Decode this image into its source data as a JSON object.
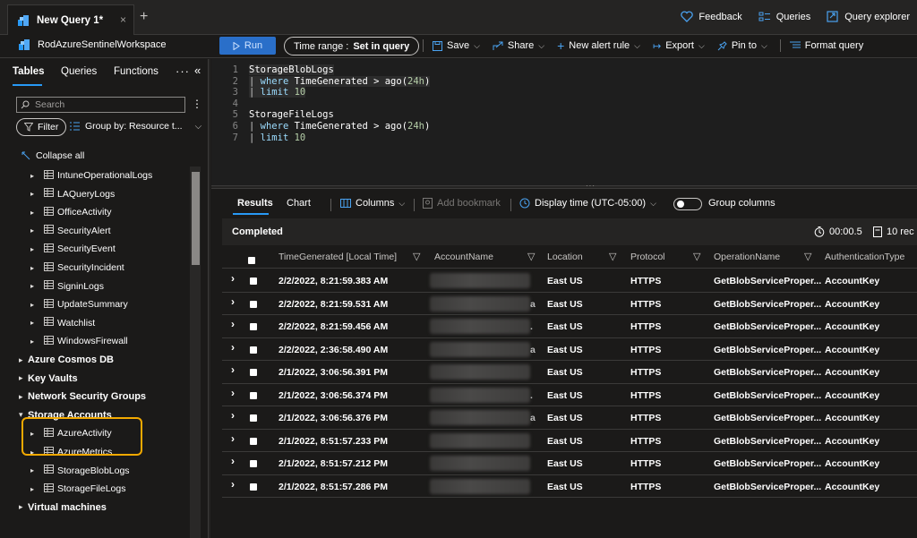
{
  "window": {
    "tab_title": "New Query 1*",
    "tab_close": "×",
    "tab_add": "+",
    "top_actions": [
      {
        "label": "Feedback",
        "icon": "heart-icon"
      },
      {
        "label": "Queries",
        "icon": "queries-icon"
      },
      {
        "label": "Query explorer",
        "icon": "query-explorer-icon"
      }
    ]
  },
  "toolbar": {
    "workspace": "RodAzureSentinelWorkspace",
    "run_label": "Run",
    "time_range_label": "Time range :",
    "time_range_value": "Set in query",
    "save_label": "Save",
    "share_label": "Share",
    "new_alert_label": "New alert rule",
    "export_label": "Export",
    "pin_label": "Pin to",
    "format_label": "Format query"
  },
  "left": {
    "tabs": [
      "Tables",
      "Queries",
      "Functions"
    ],
    "more": "···",
    "collapse": "«",
    "search_placeholder": "Search",
    "search_more": "⋮",
    "filter_label": "Filter",
    "groupby_label": "Group by: Resource t...",
    "collapse_all": "Collapse all",
    "tree": [
      {
        "label": "IntuneOperationalLogs",
        "kind": "table"
      },
      {
        "label": "LAQueryLogs",
        "kind": "table"
      },
      {
        "label": "OfficeActivity",
        "kind": "table"
      },
      {
        "label": "SecurityAlert",
        "kind": "table"
      },
      {
        "label": "SecurityEvent",
        "kind": "table"
      },
      {
        "label": "SecurityIncident",
        "kind": "table"
      },
      {
        "label": "SigninLogs",
        "kind": "table"
      },
      {
        "label": "UpdateSummary",
        "kind": "table"
      },
      {
        "label": "Watchlist",
        "kind": "table"
      },
      {
        "label": "WindowsFirewall",
        "kind": "table"
      },
      {
        "label": "Azure Cosmos DB",
        "kind": "group"
      },
      {
        "label": "Key Vaults",
        "kind": "group"
      },
      {
        "label": "Network Security Groups",
        "kind": "group"
      },
      {
        "label": "Storage Accounts",
        "kind": "group-open"
      },
      {
        "label": "AzureActivity",
        "kind": "table"
      },
      {
        "label": "AzureMetrics",
        "kind": "table"
      },
      {
        "label": "StorageBlobLogs",
        "kind": "table"
      },
      {
        "label": "StorageFileLogs",
        "kind": "table"
      },
      {
        "label": "Virtual machines",
        "kind": "group"
      }
    ]
  },
  "editor": {
    "lines": [
      {
        "n": "1",
        "segments": [
          [
            "StorageBlobLogs",
            "plain"
          ]
        ]
      },
      {
        "n": "2",
        "segments": [
          [
            "| ",
            "pipe"
          ],
          [
            "where",
            "kw"
          ],
          [
            " TimeGenerated > ago(",
            "plain"
          ],
          [
            "24h",
            "num"
          ],
          [
            ")",
            "plain"
          ]
        ]
      },
      {
        "n": "3",
        "segments": [
          [
            "| ",
            "pipe"
          ],
          [
            "limit",
            "kw"
          ],
          [
            " ",
            "plain"
          ],
          [
            "10",
            "num"
          ]
        ]
      },
      {
        "n": "4",
        "segments": []
      },
      {
        "n": "5",
        "segments": [
          [
            "StorageFileLogs",
            "plain"
          ]
        ]
      },
      {
        "n": "6",
        "segments": [
          [
            "| ",
            "pipe"
          ],
          [
            "where",
            "kw"
          ],
          [
            " TimeGenerated > ago(",
            "plain"
          ],
          [
            "24h",
            "num"
          ],
          [
            ")",
            "plain"
          ]
        ]
      },
      {
        "n": "7",
        "segments": [
          [
            "| ",
            "pipe"
          ],
          [
            "limit",
            "kw"
          ],
          [
            " ",
            "plain"
          ],
          [
            "10",
            "num"
          ]
        ]
      }
    ]
  },
  "results": {
    "tabs": [
      "Results",
      "Chart"
    ],
    "columns_label": "Columns",
    "bookmark_label": "Add bookmark",
    "display_time_label": "Display time (UTC-05:00)",
    "group_columns_label": "Group columns",
    "status": "Completed",
    "duration": "00:00.5",
    "records": "10 rec",
    "headers": [
      "TimeGenerated [Local Time]",
      "AccountName",
      "Location",
      "Protocol",
      "OperationName",
      "AuthenticationType"
    ],
    "rows": [
      {
        "time": "2/2/2022, 8:21:59.383 AM",
        "tail": "",
        "location": "East US",
        "protocol": "HTTPS",
        "operation": "GetBlobServiceProper...",
        "auth": "AccountKey"
      },
      {
        "time": "2/2/2022, 8:21:59.531 AM",
        "tail": "a",
        "location": "East US",
        "protocol": "HTTPS",
        "operation": "GetBlobServiceProper...",
        "auth": "AccountKey"
      },
      {
        "time": "2/2/2022, 8:21:59.456 AM",
        "tail": ".",
        "location": "East US",
        "protocol": "HTTPS",
        "operation": "GetBlobServiceProper...",
        "auth": "AccountKey"
      },
      {
        "time": "2/2/2022, 2:36:58.490 AM",
        "tail": "a",
        "location": "East US",
        "protocol": "HTTPS",
        "operation": "GetBlobServiceProper...",
        "auth": "AccountKey"
      },
      {
        "time": "2/1/2022, 3:06:56.391 PM",
        "tail": "",
        "location": "East US",
        "protocol": "HTTPS",
        "operation": "GetBlobServiceProper...",
        "auth": "AccountKey"
      },
      {
        "time": "2/1/2022, 3:06:56.374 PM",
        "tail": ".",
        "location": "East US",
        "protocol": "HTTPS",
        "operation": "GetBlobServiceProper...",
        "auth": "AccountKey"
      },
      {
        "time": "2/1/2022, 3:06:56.376 PM",
        "tail": "a",
        "location": "East US",
        "protocol": "HTTPS",
        "operation": "GetBlobServiceProper...",
        "auth": "AccountKey"
      },
      {
        "time": "2/1/2022, 8:51:57.233 PM",
        "tail": "",
        "location": "East US",
        "protocol": "HTTPS",
        "operation": "GetBlobServiceProper...",
        "auth": "AccountKey"
      },
      {
        "time": "2/1/2022, 8:51:57.212 PM",
        "tail": "",
        "location": "East US",
        "protocol": "HTTPS",
        "operation": "GetBlobServiceProper...",
        "auth": "AccountKey"
      },
      {
        "time": "2/1/2022, 8:51:57.286 PM",
        "tail": "",
        "location": "East US",
        "protocol": "HTTPS",
        "operation": "GetBlobServiceProper...",
        "auth": "AccountKey"
      }
    ]
  },
  "colors": {
    "accent": "#2899f5",
    "run": "#2a6fc9",
    "highlight": "#f2a900"
  }
}
